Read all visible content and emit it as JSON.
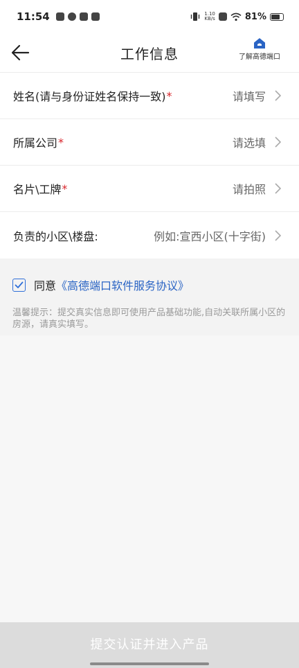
{
  "status_bar": {
    "time": "11:54",
    "net_speed_top": "1.10",
    "net_speed_bottom": "KB/s",
    "battery": "81%",
    "battery_level": 0.81
  },
  "nav": {
    "title": "工作信息",
    "help_label": "了解高德端口",
    "back_icon": "back-arrow-icon",
    "help_icon": "house-logo-icon",
    "accent": "#2a64c4"
  },
  "form": {
    "rows": [
      {
        "label": "姓名(请与身份证姓名保持一致)",
        "required": "*",
        "value": "请填写"
      },
      {
        "label": "所属公司",
        "required": "*",
        "value": "请选填"
      },
      {
        "label": "名片\\工牌",
        "required": "*",
        "value": "请拍照"
      },
      {
        "label": "负责的小区\\楼盘:",
        "required": "",
        "value": "例如:宣西小区(十字街)"
      }
    ]
  },
  "agreement": {
    "checked": true,
    "prefix": "同意",
    "link": "《高德端口软件服务协议》",
    "tip": "温馨提示：提交真实信息即可使用产品基础功能,自动关联所属小区的房源，请真实填写。"
  },
  "submit": {
    "label": "提交认证并进入产品"
  },
  "colors": {
    "required": "#d8242a",
    "link": "#2a64c4",
    "submit_bg": "#dcdcdc"
  }
}
